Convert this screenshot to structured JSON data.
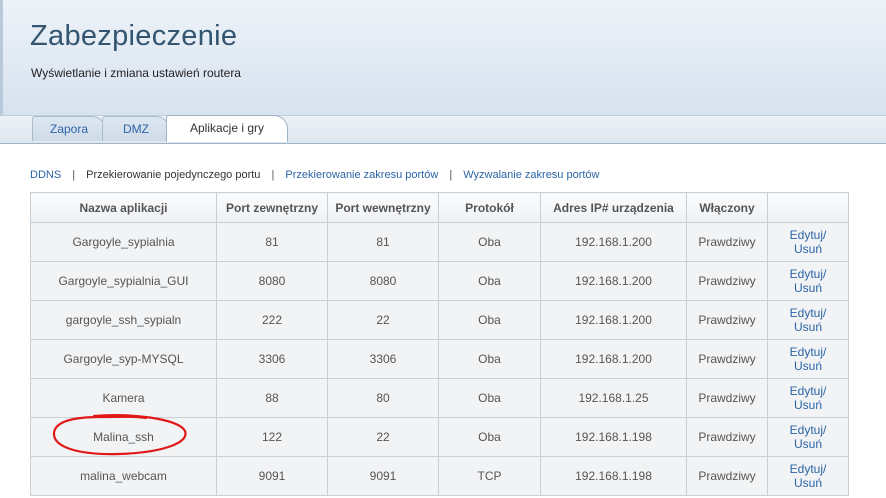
{
  "header": {
    "title": "Zabezpieczenie",
    "subtitle": "Wyświetlanie i zmiana ustawień routera"
  },
  "tabs": [
    {
      "label": "Zapora",
      "active": false
    },
    {
      "label": "DMZ",
      "active": false
    },
    {
      "label": "Aplikacje i gry",
      "active": true
    }
  ],
  "subnav": {
    "ddns": "DDNS",
    "single_port": "Przekierowanie pojedynczego portu",
    "port_range": "Przekierowanie zakresu portów",
    "range_trigger": "Wyzwalanie zakresu portów",
    "separator": "|"
  },
  "table": {
    "headers": [
      "Nazwa aplikacji",
      "Port zewnętrzny",
      "Port wewnętrzny",
      "Protokół",
      "Adres IP# urządzenia",
      "Włączony",
      ""
    ],
    "edit_label": "Edytuj/",
    "delete_label": "Usuń",
    "rows": [
      {
        "name": "Gargoyle_sypialnia",
        "ext": "81",
        "int": "81",
        "proto": "Oba",
        "ip": "192.168.1.200",
        "enabled": "Prawdziwy"
      },
      {
        "name": "Gargoyle_sypialnia_GUI",
        "ext": "8080",
        "int": "8080",
        "proto": "Oba",
        "ip": "192.168.1.200",
        "enabled": "Prawdziwy"
      },
      {
        "name": "gargoyle_ssh_sypialn",
        "ext": "222",
        "int": "22",
        "proto": "Oba",
        "ip": "192.168.1.200",
        "enabled": "Prawdziwy"
      },
      {
        "name": "Gargoyle_syp-MYSQL",
        "ext": "3306",
        "int": "3306",
        "proto": "Oba",
        "ip": "192.168.1.200",
        "enabled": "Prawdziwy"
      },
      {
        "name": "Kamera",
        "ext": "88",
        "int": "80",
        "proto": "Oba",
        "ip": "192.168.1.25",
        "enabled": "Prawdziwy"
      },
      {
        "name": "Malina_ssh",
        "ext": "122",
        "int": "22",
        "proto": "Oba",
        "ip": "192.168.1.198",
        "enabled": "Prawdziwy"
      },
      {
        "name": "malina_webcam",
        "ext": "9091",
        "int": "9091",
        "proto": "TCP",
        "ip": "192.168.1.198",
        "enabled": "Prawdziwy"
      }
    ]
  },
  "colors": {
    "link": "#2b64a6",
    "title": "#34556f",
    "annotation": "#e01818"
  }
}
